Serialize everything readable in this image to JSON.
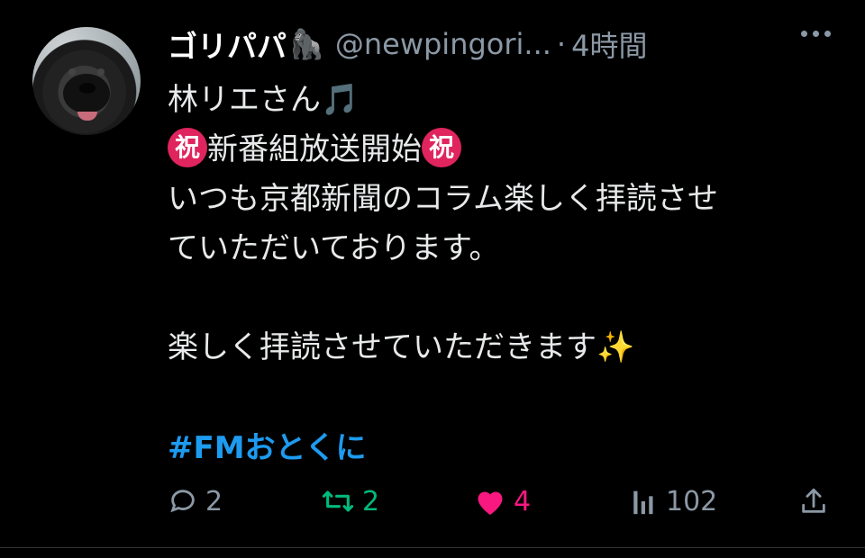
{
  "tweet": {
    "author": {
      "name": "ゴリパパ",
      "name_emoji": "🦍",
      "handle": "@newpingori...",
      "separator": "·",
      "time": "4時間"
    },
    "text": {
      "line1": "林リエさん🎵",
      "iwai_left": "祝",
      "line2_text": "新番組放送開始",
      "iwai_right": "祝",
      "line3": "いつも京都新聞のコラム楽しく拝読させ",
      "line4": "ていただいております。",
      "line5": "楽しく拝読させていただきます✨",
      "hashtag": "#FMおとくに"
    },
    "metrics": {
      "replies": "2",
      "retweets": "2",
      "likes": "4",
      "views": "102"
    },
    "colors": {
      "accent": "#1d9bf0",
      "retweet": "#00ba7c",
      "like": "#f91880",
      "muted": "#8b98a5",
      "iwai": "#e0245e"
    },
    "icons": [
      "reply-icon",
      "retweet-icon",
      "heart-icon",
      "views-icon",
      "share-icon",
      "more-icon"
    ]
  }
}
